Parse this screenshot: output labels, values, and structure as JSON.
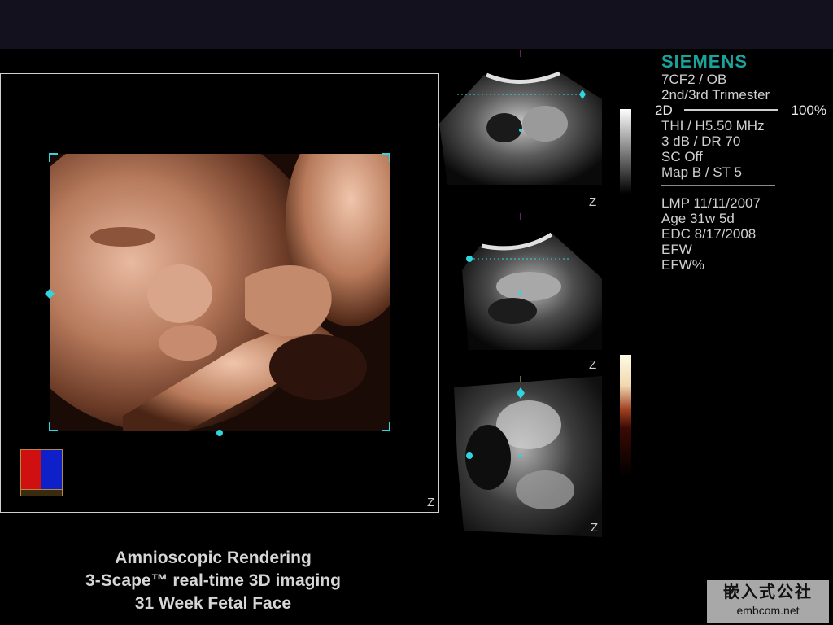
{
  "colors": {
    "accent": "#1aa39a",
    "marker": "#2fd5e0",
    "text": "#d0d0d0"
  },
  "icons": {
    "color_map": "color-map-swatch-icon",
    "z_label": "z-orientation-icon"
  },
  "viewport": {
    "z_label": "Z"
  },
  "mpr": {
    "z_label_a": "Z",
    "z_label_b": "Z",
    "z_label_c": "Z"
  },
  "info": {
    "brand": "SIEMENS",
    "transducer": "7CF2 / OB",
    "preset": "2nd/3rd Trimester",
    "mode": "2D",
    "gain": "100%",
    "thi": "THI / H5.50 MHz",
    "dr": "3 dB / DR 70",
    "sc": "SC Off",
    "map": "Map B / ST 5"
  },
  "patient": {
    "lmp": "LMP 11/11/2007",
    "age": "Age 31w 5d",
    "edc": "EDC 8/17/2008",
    "efw": "EFW",
    "efw_pct": "EFW%"
  },
  "caption": {
    "line1": "Amnioscopic Rendering",
    "line2": "3-Scape™ real-time 3D imaging",
    "line3": "31 Week Fetal Face"
  },
  "watermark": {
    "line1": "嵌入式公社",
    "line2": "embcom.net"
  }
}
